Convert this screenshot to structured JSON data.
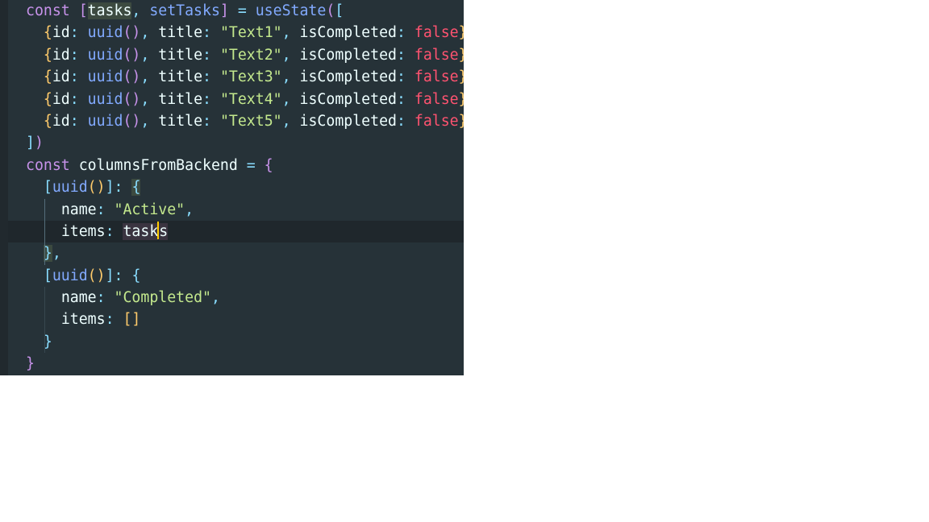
{
  "editor": {
    "lines": [
      {
        "segments": [
          {
            "t": "const",
            "c": "tok-kw"
          },
          {
            "t": " "
          },
          {
            "t": "[",
            "c": "tok-br1"
          },
          {
            "t": "tasks",
            "c": "tok-id tok-hl"
          },
          {
            "t": ", ",
            "c": "tok-punc"
          },
          {
            "t": "setTasks",
            "c": "tok-fn"
          },
          {
            "t": "] ",
            "c": "tok-br1"
          },
          {
            "t": "= ",
            "c": "tok-punc"
          },
          {
            "t": "useState",
            "c": "tok-fn"
          },
          {
            "t": "(",
            "c": "tok-br1"
          },
          {
            "t": "[",
            "c": "tok-br2"
          }
        ]
      },
      {
        "indent": "  ",
        "segments": [
          {
            "t": "{",
            "c": "tok-br3"
          },
          {
            "t": "id",
            "c": "tok-prop"
          },
          {
            "t": ": ",
            "c": "tok-punc"
          },
          {
            "t": "uuid",
            "c": "tok-fn"
          },
          {
            "t": "()",
            "c": "tok-br1"
          },
          {
            "t": ", ",
            "c": "tok-punc"
          },
          {
            "t": "title",
            "c": "tok-prop"
          },
          {
            "t": ": ",
            "c": "tok-punc"
          },
          {
            "t": "\"Text1\"",
            "c": "tok-str"
          },
          {
            "t": ", ",
            "c": "tok-punc"
          },
          {
            "t": "isCompleted",
            "c": "tok-prop"
          },
          {
            "t": ": ",
            "c": "tok-punc"
          },
          {
            "t": "false",
            "c": "tok-bool"
          },
          {
            "t": "}",
            "c": "tok-br3"
          }
        ]
      },
      {
        "indent": "  ",
        "segments": [
          {
            "t": "{",
            "c": "tok-br3"
          },
          {
            "t": "id",
            "c": "tok-prop"
          },
          {
            "t": ": ",
            "c": "tok-punc"
          },
          {
            "t": "uuid",
            "c": "tok-fn"
          },
          {
            "t": "()",
            "c": "tok-br1"
          },
          {
            "t": ", ",
            "c": "tok-punc"
          },
          {
            "t": "title",
            "c": "tok-prop"
          },
          {
            "t": ": ",
            "c": "tok-punc"
          },
          {
            "t": "\"Text2\"",
            "c": "tok-str"
          },
          {
            "t": ", ",
            "c": "tok-punc"
          },
          {
            "t": "isCompleted",
            "c": "tok-prop"
          },
          {
            "t": ": ",
            "c": "tok-punc"
          },
          {
            "t": "false",
            "c": "tok-bool"
          },
          {
            "t": "}",
            "c": "tok-br3"
          }
        ]
      },
      {
        "indent": "  ",
        "segments": [
          {
            "t": "{",
            "c": "tok-br3"
          },
          {
            "t": "id",
            "c": "tok-prop"
          },
          {
            "t": ": ",
            "c": "tok-punc"
          },
          {
            "t": "uuid",
            "c": "tok-fn"
          },
          {
            "t": "()",
            "c": "tok-br1"
          },
          {
            "t": ", ",
            "c": "tok-punc"
          },
          {
            "t": "title",
            "c": "tok-prop"
          },
          {
            "t": ": ",
            "c": "tok-punc"
          },
          {
            "t": "\"Text3\"",
            "c": "tok-str"
          },
          {
            "t": ", ",
            "c": "tok-punc"
          },
          {
            "t": "isCompleted",
            "c": "tok-prop"
          },
          {
            "t": ": ",
            "c": "tok-punc"
          },
          {
            "t": "false",
            "c": "tok-bool"
          },
          {
            "t": "}",
            "c": "tok-br3"
          }
        ]
      },
      {
        "indent": "  ",
        "segments": [
          {
            "t": "{",
            "c": "tok-br3"
          },
          {
            "t": "id",
            "c": "tok-prop"
          },
          {
            "t": ": ",
            "c": "tok-punc"
          },
          {
            "t": "uuid",
            "c": "tok-fn"
          },
          {
            "t": "()",
            "c": "tok-br1"
          },
          {
            "t": ", ",
            "c": "tok-punc"
          },
          {
            "t": "title",
            "c": "tok-prop"
          },
          {
            "t": ": ",
            "c": "tok-punc"
          },
          {
            "t": "\"Text4\"",
            "c": "tok-str"
          },
          {
            "t": ", ",
            "c": "tok-punc"
          },
          {
            "t": "isCompleted",
            "c": "tok-prop"
          },
          {
            "t": ": ",
            "c": "tok-punc"
          },
          {
            "t": "false",
            "c": "tok-bool"
          },
          {
            "t": "}",
            "c": "tok-br3"
          }
        ]
      },
      {
        "indent": "  ",
        "segments": [
          {
            "t": "{",
            "c": "tok-br3"
          },
          {
            "t": "id",
            "c": "tok-prop"
          },
          {
            "t": ": ",
            "c": "tok-punc"
          },
          {
            "t": "uuid",
            "c": "tok-fn"
          },
          {
            "t": "()",
            "c": "tok-br1"
          },
          {
            "t": ", ",
            "c": "tok-punc"
          },
          {
            "t": "title",
            "c": "tok-prop"
          },
          {
            "t": ": ",
            "c": "tok-punc"
          },
          {
            "t": "\"Text5\"",
            "c": "tok-str"
          },
          {
            "t": ", ",
            "c": "tok-punc"
          },
          {
            "t": "isCompleted",
            "c": "tok-prop"
          },
          {
            "t": ": ",
            "c": "tok-punc"
          },
          {
            "t": "false",
            "c": "tok-bool"
          },
          {
            "t": "}",
            "c": "tok-br3"
          }
        ]
      },
      {
        "segments": [
          {
            "t": "]",
            "c": "tok-br2"
          },
          {
            "t": ")",
            "c": "tok-br1"
          }
        ]
      },
      {
        "segments": [
          {
            "t": "const",
            "c": "tok-kw"
          },
          {
            "t": " "
          },
          {
            "t": "columnsFromBackend",
            "c": "tok-id"
          },
          {
            "t": " = ",
            "c": "tok-punc"
          },
          {
            "t": "{",
            "c": "tok-br1"
          }
        ]
      },
      {
        "indent": "  ",
        "segments": [
          {
            "t": "[",
            "c": "tok-br2"
          },
          {
            "t": "uuid",
            "c": "tok-fn"
          },
          {
            "t": "()",
            "c": "tok-br3"
          },
          {
            "t": "]",
            "c": "tok-br2"
          },
          {
            "t": ": ",
            "c": "tok-punc"
          },
          {
            "t": "{",
            "c": "tok-br2 tok-hl"
          }
        ]
      },
      {
        "indent": "    ",
        "segments": [
          {
            "t": "name",
            "c": "tok-prop"
          },
          {
            "t": ": ",
            "c": "tok-punc"
          },
          {
            "t": "\"Active\"",
            "c": "tok-str"
          },
          {
            "t": ",",
            "c": "tok-punc"
          }
        ]
      },
      {
        "indent": "    ",
        "current": true,
        "segments": [
          {
            "t": "items",
            "c": "tok-prop"
          },
          {
            "t": ": ",
            "c": "tok-punc"
          },
          {
            "t": "task",
            "c": "tok-id tok-hl2"
          },
          {
            "t": "CURSOR"
          },
          {
            "t": "s",
            "c": "tok-id tok-hl2"
          }
        ]
      },
      {
        "indent": "  ",
        "segments": [
          {
            "t": "}",
            "c": "tok-br2 tok-hl"
          },
          {
            "t": ",",
            "c": "tok-punc"
          }
        ]
      },
      {
        "indent": "  ",
        "segments": [
          {
            "t": "[",
            "c": "tok-br2"
          },
          {
            "t": "uuid",
            "c": "tok-fn"
          },
          {
            "t": "()",
            "c": "tok-br3"
          },
          {
            "t": "]",
            "c": "tok-br2"
          },
          {
            "t": ": ",
            "c": "tok-punc"
          },
          {
            "t": "{",
            "c": "tok-br2"
          }
        ]
      },
      {
        "indent": "    ",
        "segments": [
          {
            "t": "name",
            "c": "tok-prop"
          },
          {
            "t": ": ",
            "c": "tok-punc"
          },
          {
            "t": "\"Completed\"",
            "c": "tok-str"
          },
          {
            "t": ",",
            "c": "tok-punc"
          }
        ]
      },
      {
        "indent": "    ",
        "segments": [
          {
            "t": "items",
            "c": "tok-prop"
          },
          {
            "t": ": ",
            "c": "tok-punc"
          },
          {
            "t": "[]",
            "c": "tok-br3"
          }
        ]
      },
      {
        "indent": "  ",
        "segments": [
          {
            "t": "}",
            "c": "tok-br2"
          }
        ]
      },
      {
        "segments": [
          {
            "t": "}",
            "c": "tok-br1"
          }
        ]
      }
    ]
  }
}
